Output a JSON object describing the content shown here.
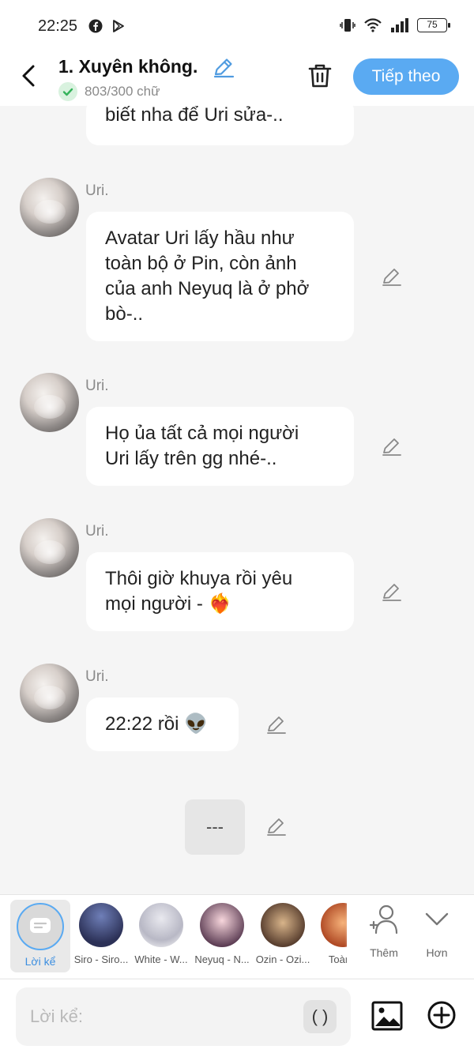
{
  "status_bar": {
    "time": "22:25",
    "battery": "75",
    "icons": [
      "facebook-icon",
      "play-store-icon",
      "vibrate-icon",
      "wifi-icon",
      "signal-icon",
      "battery-icon"
    ]
  },
  "header": {
    "title": "1. Xuyên không.",
    "word_count": "803/300 chữ",
    "next_label": "Tiếp theo"
  },
  "messages": [
    {
      "sender": "",
      "text": "biết nha để Uri sửa-.."
    },
    {
      "sender": "Uri.",
      "text": "Avatar Uri lấy hầu như\ntoàn bộ ở Pin, còn ảnh\ncủa anh Neyuq là ở phở\nbò-.."
    },
    {
      "sender": "Uri.",
      "text": "Họ ủa tất cả mọi người\nUri lấy trên gg nhé-.."
    },
    {
      "sender": "Uri.",
      "text": "Thôi giờ khuya rồi yêu\nmọi người - ❤️‍🔥"
    },
    {
      "sender": "Uri.",
      "text": "22:22 rồi 👽"
    }
  ],
  "divider": "---",
  "characters": {
    "narrator_label": "Lời kể",
    "items": [
      {
        "label": "Siro - Siro..."
      },
      {
        "label": "White - W..."
      },
      {
        "label": "Neyuq - N..."
      },
      {
        "label": "Ozin - Ozi..."
      },
      {
        "label": "Toàn -"
      }
    ],
    "add_label": "Thêm",
    "more_label": "Hơn"
  },
  "input": {
    "placeholder": "Lời kể:",
    "paren_label": "( )"
  },
  "colors": {
    "accent": "#5aaaf2",
    "background": "#f5f5f5",
    "bubble": "#ffffff",
    "check_green": "#34b35a"
  }
}
